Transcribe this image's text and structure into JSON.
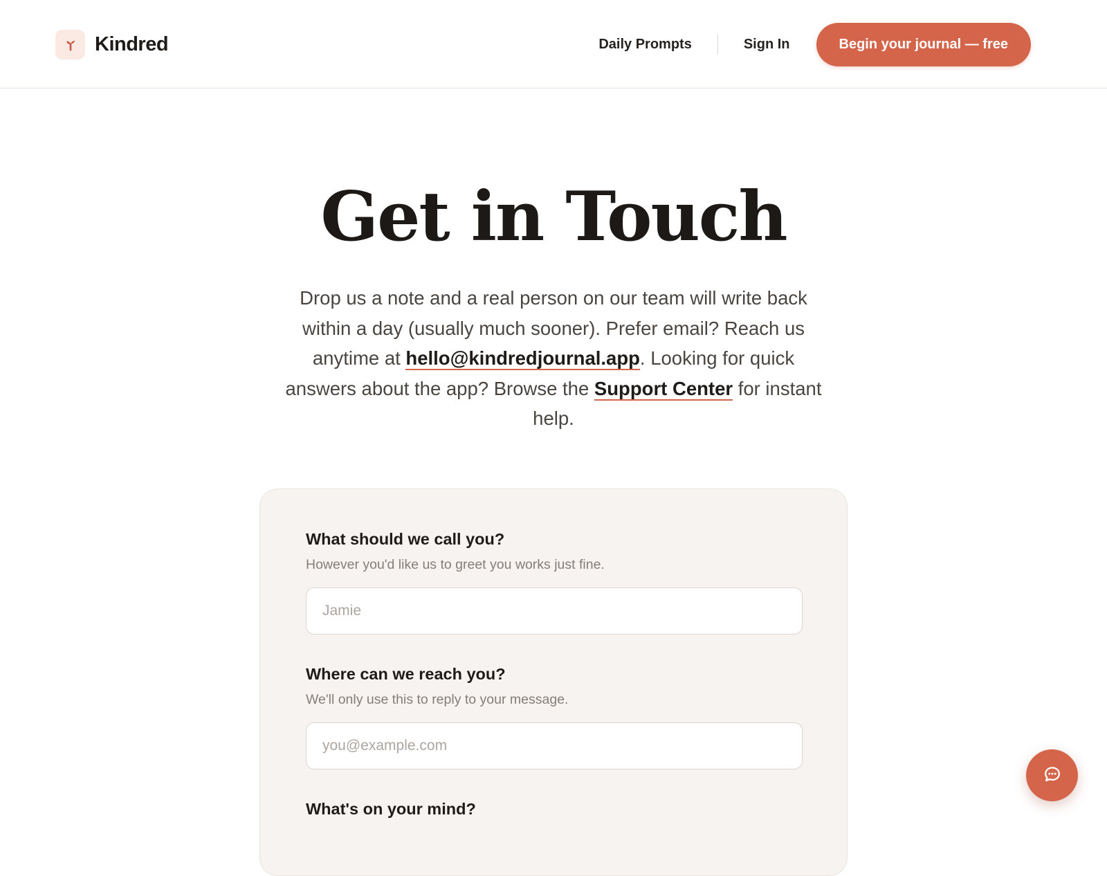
{
  "header": {
    "brand": "Kindred",
    "nav": {
      "daily_prompts": "Daily Prompts",
      "sign_in": "Sign In",
      "cta": "Begin your journal — free"
    }
  },
  "hero": {
    "title": "Get in Touch",
    "text_1": "Drop us a note and a real person on our team will write back within a day (usually much sooner). Prefer email? Reach us anytime at ",
    "email_link": "hello@kindredjournal.app",
    "text_2": ". Looking for quick answers about the app? Browse the ",
    "support_link": "Support Center",
    "text_3": " for instant help."
  },
  "form": {
    "name": {
      "label": "What should we call you?",
      "help": "However you'd like us to greet you works just fine.",
      "placeholder": "Jamie",
      "value": ""
    },
    "email": {
      "label": "Where can we reach you?",
      "help": "We'll only use this to reply to your message.",
      "placeholder": "you@example.com",
      "value": ""
    },
    "message": {
      "label": "What's on your mind?"
    }
  },
  "icons": {
    "logo": "sprout-icon",
    "chat": "chat-bubble-icon"
  },
  "colors": {
    "accent": "#d4644a",
    "logo_bg": "#fbe9e3",
    "card_bg": "#f6f3f0",
    "text": "#1f1b18",
    "muted": "#857d77"
  }
}
